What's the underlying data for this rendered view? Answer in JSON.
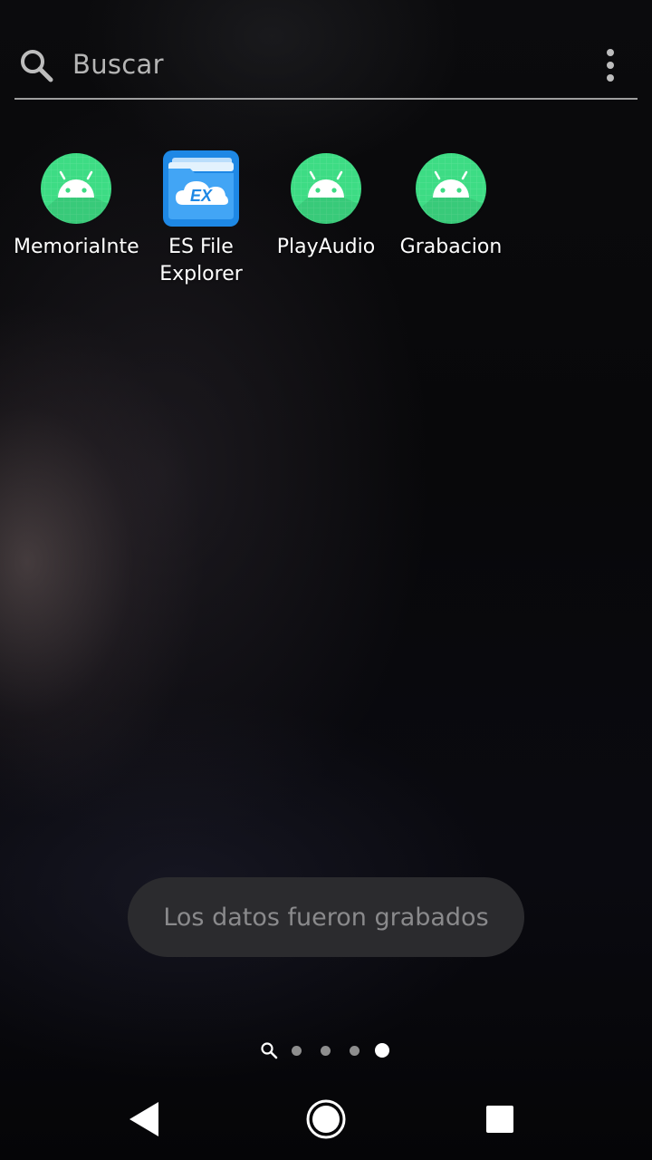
{
  "search": {
    "label": "Buscar",
    "icon": "search-icon",
    "menu_icon": "overflow-menu-icon"
  },
  "apps": [
    {
      "label": "MemoriaInte",
      "icon": "android-icon",
      "color": "#3ddc84"
    },
    {
      "label": "ES File Explorer",
      "icon": "es-file-explorer-icon",
      "color": "#1e88e5"
    },
    {
      "label": "PlayAudio",
      "icon": "android-icon",
      "color": "#3ddc84"
    },
    {
      "label": "Grabacion",
      "icon": "android-icon",
      "color": "#3ddc84"
    }
  ],
  "es_icon_text": "EX",
  "toast": {
    "message": "Los datos fueron grabados"
  },
  "page_indicator": {
    "pages": 4,
    "current": 4
  },
  "nav": {
    "back": "back-icon",
    "home": "home-icon",
    "recents": "recents-icon"
  }
}
